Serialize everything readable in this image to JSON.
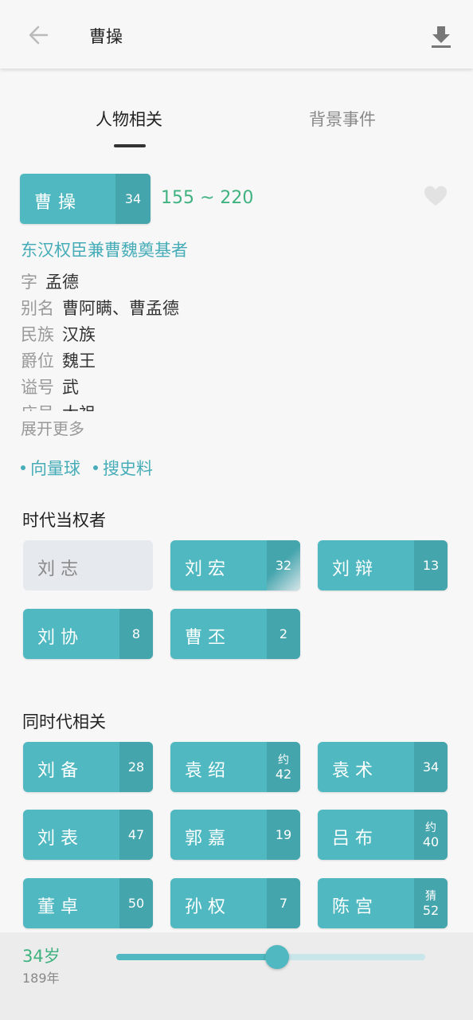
{
  "header": {
    "title": "曹操",
    "back_icon": "arrow-left-icon",
    "download_icon": "download-icon"
  },
  "tabs": [
    {
      "label": "人物相关",
      "active": true
    },
    {
      "label": "背景事件",
      "active": false
    }
  ],
  "person": {
    "name": "曹操",
    "age": "34",
    "years": "155 ~ 220",
    "favorite_icon": "heart-icon",
    "subtitle": "东汉权臣兼曹魏奠基者",
    "info": [
      {
        "label": "字",
        "value": "孟德"
      },
      {
        "label": "别名",
        "value": "曹阿瞒、曹孟德"
      },
      {
        "label": "民族",
        "value": "汉族"
      },
      {
        "label": "爵位",
        "value": "魏王"
      },
      {
        "label": "谥号",
        "value": "武"
      },
      {
        "label": "庙号",
        "value": "太祖"
      }
    ],
    "expand_label": "展开更多"
  },
  "links": [
    {
      "label": "向量球"
    },
    {
      "label": "搜史料"
    }
  ],
  "rulers": {
    "title": "时代当权者",
    "items": [
      {
        "name": "刘志",
        "age": ""
      },
      {
        "name": "刘宏",
        "age": "32"
      },
      {
        "name": "刘辩",
        "age": "13"
      },
      {
        "name": "刘协",
        "age": "8"
      },
      {
        "name": "曹丕",
        "age": "2"
      }
    ]
  },
  "contemporaries": {
    "title": "同时代相关",
    "items": [
      {
        "name": "刘备",
        "prefix": "",
        "age": "28"
      },
      {
        "name": "袁绍",
        "prefix": "约",
        "age": "42"
      },
      {
        "name": "袁术",
        "prefix": "",
        "age": "34"
      },
      {
        "name": "刘表",
        "prefix": "",
        "age": "47"
      },
      {
        "name": "郭嘉",
        "prefix": "",
        "age": "19"
      },
      {
        "name": "吕布",
        "prefix": "约",
        "age": "40"
      },
      {
        "name": "董卓",
        "prefix": "",
        "age": "50"
      },
      {
        "name": "孙权",
        "prefix": "",
        "age": "7"
      },
      {
        "name": "陈宫",
        "prefix": "猜",
        "age": "52"
      }
    ]
  },
  "timeline": {
    "age_label": "34岁",
    "year_label": "189年",
    "progress": 0.52,
    "accent": "#4fb8c0"
  }
}
